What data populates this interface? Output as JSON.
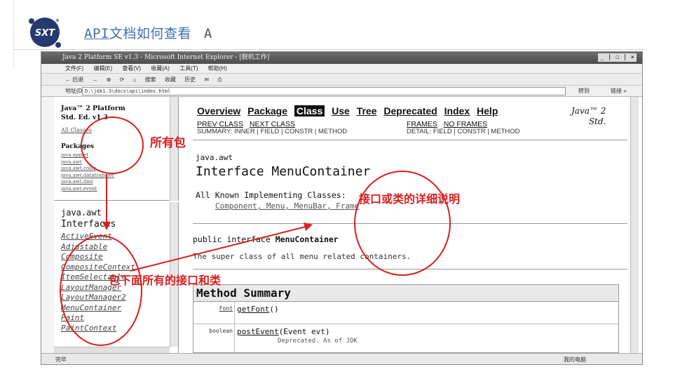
{
  "slide": {
    "logo_text": "SXT",
    "title_code": "API",
    "title_text": "文档如何查看",
    "title_suffix": "A"
  },
  "browser": {
    "window_title": "Java 2 Platform SE v1.3 - Microsoft Internet Explorer - [脱机工作]",
    "window_buttons": "_ | ☐ | ×",
    "menu_items": [
      "文件(F)",
      "编辑(E)",
      "查看(V)",
      "收藏(A)",
      "工具(T)",
      "帮助(H)"
    ],
    "toolbar_items": [
      "← 后退",
      "→",
      "⊗",
      "⟳",
      "⌂",
      "搜索",
      "收藏",
      "历史",
      "✉",
      "⎙"
    ],
    "address_label": "地址(D)",
    "address_value": "D:\\jdk1.3\\docs\\api\\index.html",
    "go_label": "转到",
    "links_label": "链接 »",
    "status_left": "完毕",
    "status_right": "我的电脑"
  },
  "left_top_frame": {
    "heading_line1": "Java™ 2 Platform",
    "heading_line2": "Std. Ed. v1.3",
    "all_classes": "All Classes",
    "packages_heading": "Packages",
    "packages": [
      "java.applet",
      "java.awt",
      "java.awt.color",
      "java.awt.datatransfer",
      "java.awt.dnd",
      "java.awt.event"
    ]
  },
  "left_bottom_frame": {
    "package": "java.awt",
    "interfaces_heading": "Interfaces",
    "interfaces": [
      "ActiveEvent",
      "Adjustable",
      "Composite",
      "CompositeContext",
      "ItemSelectable",
      "LayoutManager",
      "LayoutManager2",
      "MenuContainer",
      "Paint",
      "PaintContext"
    ]
  },
  "main_frame": {
    "nav": [
      "Overview",
      "Package",
      "Class",
      "Use",
      "Tree",
      "Deprecated",
      "Index",
      "Help"
    ],
    "nav_active": "Class",
    "java_label_line1": "Java™ 2",
    "java_label_line2": "Std.",
    "prev_class": "PREV CLASS",
    "next_class": "NEXT CLASS",
    "frames": "FRAMES",
    "no_frames": "NO FRAMES",
    "summary_line": "SUMMARY: INNER | FIELD | CONSTR | METHOD",
    "detail_line": "DETAIL: FIELD | CONSTR | METHOD",
    "package_name": "java.awt",
    "interface_title": "Interface MenuContainer",
    "implementing_heading": "All Known Implementing Classes:",
    "implementing_classes": "Component, Menu, MenuBar, Frame",
    "declaration_prefix": "public interface ",
    "declaration_name": "MenuContainer",
    "description": "The super class of all menu related containers.",
    "method_summary_title": "Method Summary",
    "methods": [
      {
        "type": "Font",
        "name": "getFont",
        "params": "()",
        "desc": ""
      },
      {
        "type": "boolean",
        "name": "postEvent",
        "params": "(Event evt)",
        "desc": "Deprecated. As of JDK"
      }
    ]
  },
  "annotations": {
    "all_packages": "所有包",
    "interface_detail": "接口或类的详细说明",
    "classes_under_package": "包下面所有的接口和类"
  },
  "colors": {
    "title_blue": "#3d6fb6",
    "annotation_red": "#d81e1e",
    "logo_navy": "#253a6e"
  }
}
